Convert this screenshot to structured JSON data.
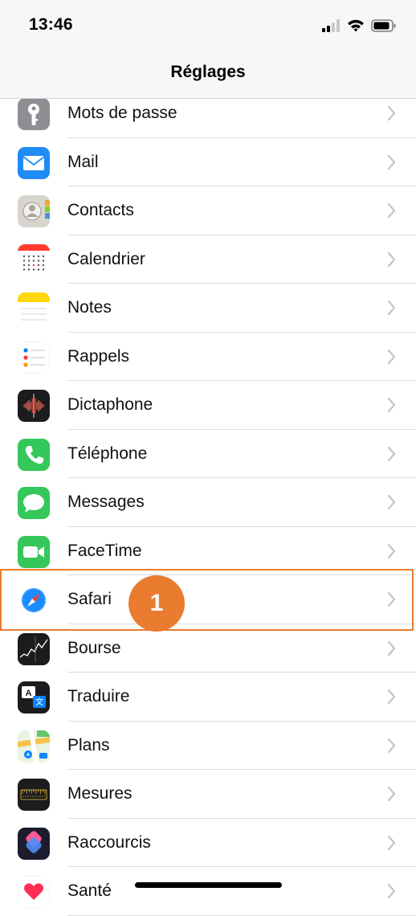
{
  "status": {
    "time": "13:46"
  },
  "nav": {
    "title": "Réglages"
  },
  "rows": [
    {
      "label": "Mots de passe",
      "icon": "key-icon",
      "color": "#8e8e93"
    },
    {
      "label": "Mail",
      "icon": "mail-icon",
      "color": "#1f8bf5"
    },
    {
      "label": "Contacts",
      "icon": "contacts-icon",
      "color": "#c7c4bd"
    },
    {
      "label": "Calendrier",
      "icon": "calendar-icon",
      "color": "#ff3b30"
    },
    {
      "label": "Notes",
      "icon": "notes-icon",
      "color": "#ffd60a"
    },
    {
      "label": "Rappels",
      "icon": "reminders-icon",
      "color": "#ffffff"
    },
    {
      "label": "Dictaphone",
      "icon": "voice-memos-icon",
      "color": "#1c1c1e"
    },
    {
      "label": "Téléphone",
      "icon": "phone-icon",
      "color": "#34c759"
    },
    {
      "label": "Messages",
      "icon": "messages-icon",
      "color": "#34c759"
    },
    {
      "label": "FaceTime",
      "icon": "facetime-icon",
      "color": "#34c759"
    },
    {
      "label": "Safari",
      "icon": "safari-icon",
      "color": "#1a8cff"
    },
    {
      "label": "Bourse",
      "icon": "stocks-icon",
      "color": "#1c1c1e"
    },
    {
      "label": "Traduire",
      "icon": "translate-icon",
      "color": "#1c1c1e"
    },
    {
      "label": "Plans",
      "icon": "maps-icon",
      "color": "#65c466"
    },
    {
      "label": "Mesures",
      "icon": "measure-icon",
      "color": "#1c1c1e"
    },
    {
      "label": "Raccourcis",
      "icon": "shortcuts-icon",
      "color": "#5b3fd6"
    },
    {
      "label": "Santé",
      "icon": "health-icon",
      "color": "#ffffff"
    }
  ],
  "annotation": {
    "step": "1",
    "color": "#e97c2f"
  }
}
